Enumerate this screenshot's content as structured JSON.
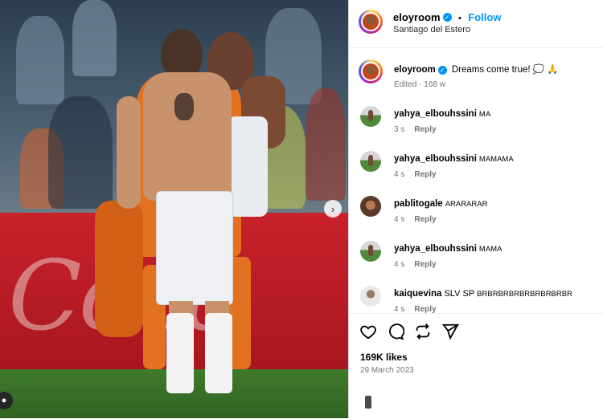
{
  "post": {
    "username": "eloyroom",
    "follow_label": "Follow",
    "location": "Santiago del Estero",
    "separator": "•"
  },
  "caption": {
    "username": "eloyroom",
    "text": "Dreams come true! 💭 🙏",
    "edited": "Edited",
    "age": "168 w"
  },
  "comments": [
    {
      "username": "yahya_elbouhssini",
      "text": "MA",
      "time": "3 s",
      "reply": "Reply"
    },
    {
      "username": "yahya_elbouhssini",
      "text": "MAMAMA",
      "time": "4 s",
      "reply": "Reply"
    },
    {
      "username": "pablitogale",
      "text": "ARARARAR",
      "time": "4 s",
      "reply": "Reply"
    },
    {
      "username": "yahya_elbouhssini",
      "text": "MAMA",
      "time": "4 s",
      "reply": "Reply"
    },
    {
      "username": "kaiquevina",
      "text": "SLV SP",
      "extra": "BRBRBRBRBRBRBRBRBR",
      "time": "4 s",
      "reply": "Reply"
    }
  ],
  "stats": {
    "likes": "169K likes",
    "date": "29 March 2023"
  },
  "icons": [
    "heart-icon",
    "comment-icon",
    "repost-icon",
    "share-icon",
    "next-arrow-icon",
    "verified-icon",
    "user-icon"
  ],
  "colors": {
    "accent": "#0095f6",
    "board": "#c8222b"
  }
}
